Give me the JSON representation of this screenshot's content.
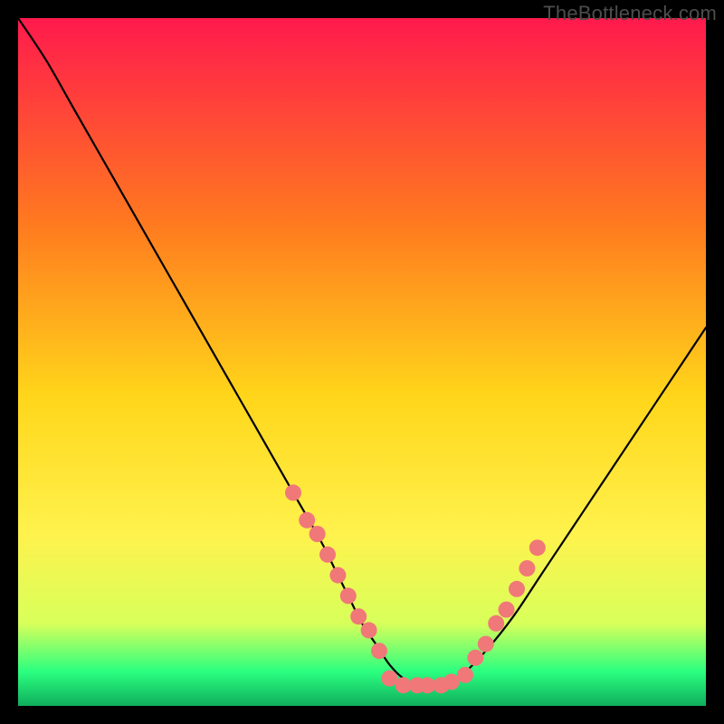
{
  "watermark": "TheBottleneck.com",
  "colors": {
    "bg_black": "#000000",
    "curve": "#000000",
    "dots": "#f07878",
    "grad_top": "#ff1a4d",
    "grad_mid1": "#ff7a1f",
    "grad_mid2": "#ffd61a",
    "grad_mid3": "#fff24d",
    "grad_yellowgreen": "#d8ff5a",
    "grad_green": "#2bff80",
    "grad_deepgreen": "#0fae5c"
  },
  "chart_data": {
    "type": "line",
    "title": "",
    "xlabel": "",
    "ylabel": "",
    "xlim": [
      0,
      100
    ],
    "ylim": [
      0,
      100
    ],
    "x": [
      0,
      4,
      8,
      12,
      16,
      20,
      24,
      28,
      32,
      36,
      40,
      44,
      46,
      48,
      50,
      52,
      54,
      56,
      58,
      60,
      62,
      64,
      68,
      72,
      76,
      80,
      84,
      88,
      92,
      96,
      100
    ],
    "values": [
      100,
      94,
      87,
      80,
      73,
      66,
      59,
      52,
      45,
      38,
      31,
      24,
      20,
      16,
      12,
      9,
      6,
      4,
      3,
      3,
      3,
      4,
      8,
      13,
      19,
      25,
      31,
      37,
      43,
      49,
      55
    ],
    "plateau_y": 3,
    "dots_left": [
      {
        "x": 40,
        "y": 31
      },
      {
        "x": 42,
        "y": 27
      },
      {
        "x": 43.5,
        "y": 25
      },
      {
        "x": 45,
        "y": 22
      },
      {
        "x": 46.5,
        "y": 19
      },
      {
        "x": 48,
        "y": 16
      },
      {
        "x": 49.5,
        "y": 13
      },
      {
        "x": 51,
        "y": 11
      },
      {
        "x": 52.5,
        "y": 8
      }
    ],
    "dots_bottom": [
      {
        "x": 54,
        "y": 4
      },
      {
        "x": 56,
        "y": 3
      },
      {
        "x": 58,
        "y": 3
      },
      {
        "x": 59.5,
        "y": 3
      },
      {
        "x": 61.5,
        "y": 3
      },
      {
        "x": 63,
        "y": 3.5
      },
      {
        "x": 65,
        "y": 4.5
      }
    ],
    "dots_right": [
      {
        "x": 66.5,
        "y": 7
      },
      {
        "x": 68,
        "y": 9
      },
      {
        "x": 69.5,
        "y": 12
      },
      {
        "x": 71,
        "y": 14
      },
      {
        "x": 72.5,
        "y": 17
      },
      {
        "x": 74,
        "y": 20
      },
      {
        "x": 75.5,
        "y": 23
      }
    ]
  }
}
